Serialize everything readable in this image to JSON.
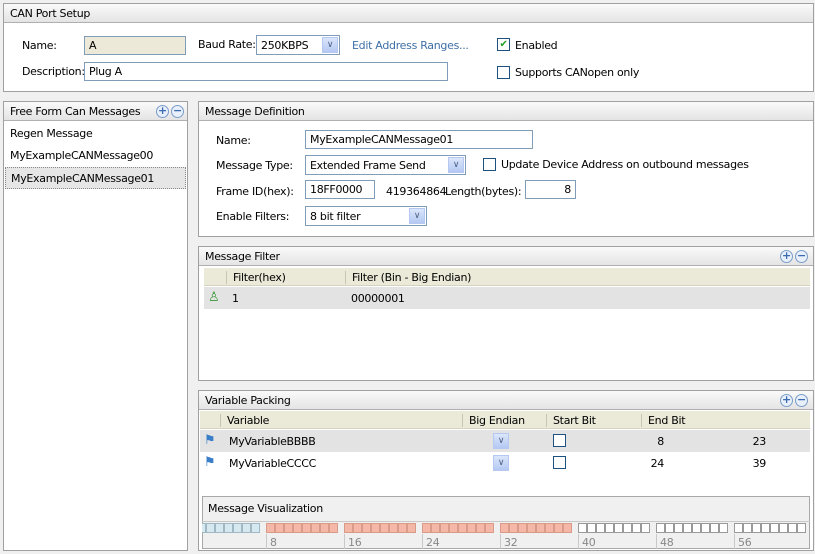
{
  "port_setup": {
    "title": "CAN Port Setup",
    "name_label": "Name:",
    "name_value": "A",
    "baud_label": "Baud Rate:",
    "baud_value": "250KBPS",
    "edit_ranges": "Edit Address Ranges...",
    "enabled_label": "Enabled",
    "enabled": true,
    "canopen_label": "Supports CANopen only",
    "canopen": false,
    "description_label": "Description:",
    "description_value": "Plug A"
  },
  "messages": {
    "title": "Free Form Can Messages",
    "items": [
      "Regen Message",
      "MyExampleCANMessage00",
      "MyExampleCANMessage01"
    ],
    "selected": 2
  },
  "definition": {
    "title": "Message  Definition",
    "name_label": "Name:",
    "name_value": "MyExampleCANMessage01",
    "type_label": "Message Type:",
    "type_value": "Extended Frame Send",
    "update_label": "Update Device Address on outbound messages",
    "update_checked": false,
    "frame_label": "Frame ID(hex):",
    "frame_value": "18FF0000",
    "frame_decimal": "419364864",
    "length_label": "Length(bytes):",
    "length_value": "8",
    "filters_label": "Enable Filters:",
    "filters_value": "8 bit filter"
  },
  "filter": {
    "title": "Message Filter",
    "columns": [
      "Filter(hex)",
      "Filter (Bin - Big Endian)"
    ],
    "rows": [
      {
        "hex": "1",
        "bin": "00000001"
      }
    ]
  },
  "packing": {
    "title": "Variable Packing",
    "columns": [
      "Variable",
      "Big Endian",
      "Start Bit",
      "End Bit"
    ],
    "rows": [
      {
        "variable": "MyVariableBBBB",
        "big_endian": false,
        "start": "8",
        "end": "23"
      },
      {
        "variable": "MyVariableCCCC",
        "big_endian": false,
        "start": "24",
        "end": "39"
      }
    ]
  },
  "visualization": {
    "title": "Message Visualization",
    "tick_labels": [
      "8",
      "16",
      "24",
      "32",
      "40",
      "48",
      "56"
    ],
    "byte_states": [
      "header",
      "used",
      "used",
      "used",
      "used",
      "free",
      "free",
      "free"
    ],
    "colors": {
      "header": "#d6e8f0",
      "used": "#f5b8a8",
      "free": "#ffffff"
    }
  }
}
